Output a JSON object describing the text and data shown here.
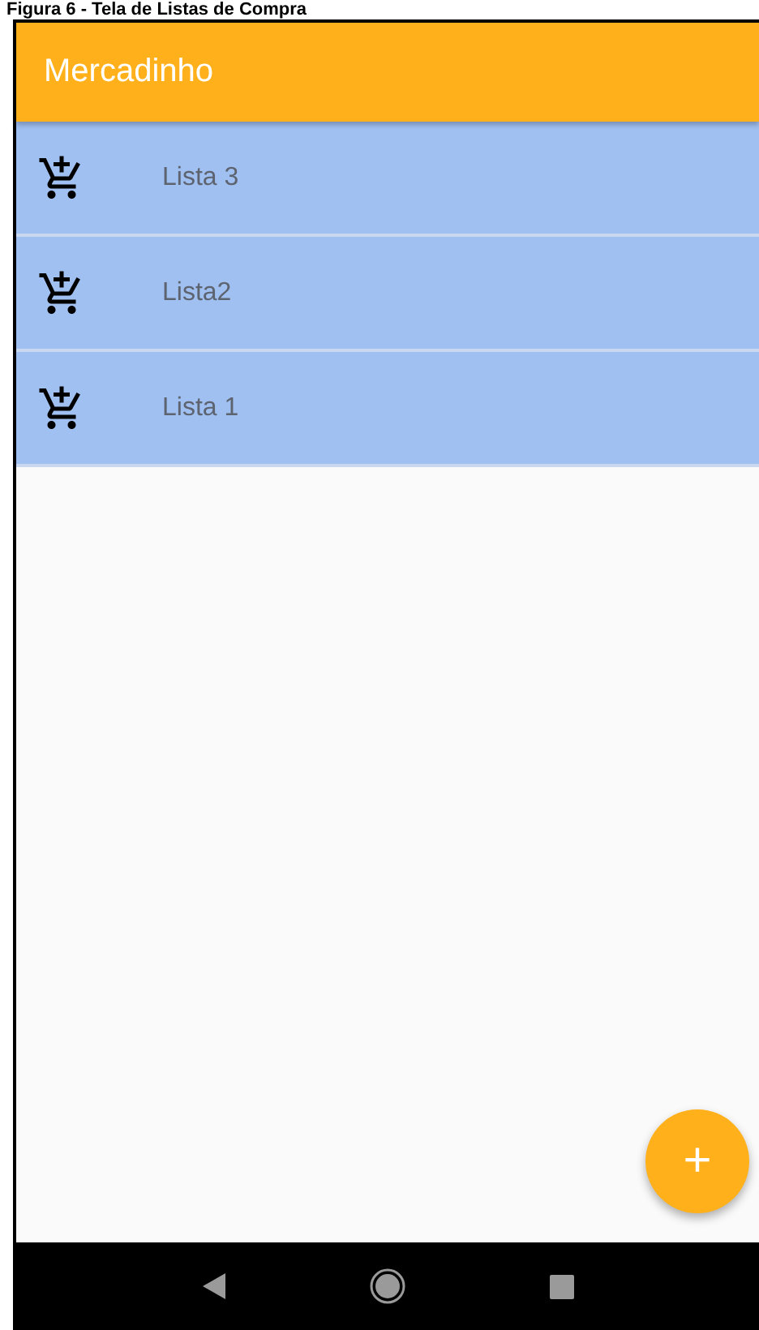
{
  "caption": "Figura 6 - Tela de Listas de Compra",
  "app_bar": {
    "title": "Mercadinho"
  },
  "lists": [
    {
      "name": "Lista 3"
    },
    {
      "name": "Lista2"
    },
    {
      "name": "Lista 1"
    }
  ],
  "fab": {
    "label": "+"
  }
}
